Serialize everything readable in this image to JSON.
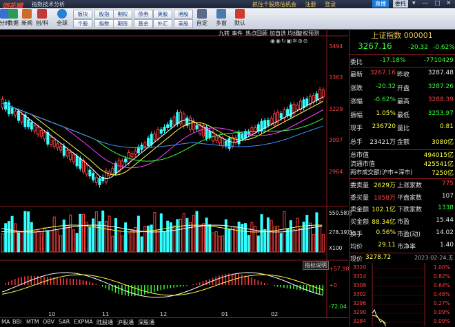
{
  "app": {
    "logo": "同花顺",
    "title": "指数技术分析",
    "links": [
      "抓住个股炼估机会",
      "注册",
      "登录"
    ],
    "live_label": "直播",
    "delegate_label": "委托",
    "window_controls": [
      "▾",
      "—",
      "□",
      "✕"
    ]
  },
  "toolbar": {
    "items": [
      {
        "label": "分时",
        "icon": "timeshare-icon"
      },
      {
        "label": "数据",
        "icon": "data-icon"
      },
      {
        "label": "新闻",
        "icon": "news-icon"
      },
      {
        "label": "创/科",
        "icon": "star-market-icon"
      },
      {
        "label": "全球",
        "icon": "globe-icon"
      }
    ],
    "buttons_row1": [
      "板块",
      "股指",
      "期权",
      "债券",
      "英股",
      "港股"
    ],
    "buttons_row2": [
      "个股",
      "指数",
      "期货",
      "基金",
      "外汇",
      "美股"
    ],
    "right_items": [
      {
        "label": "自定",
        "icon": "custom-icon"
      },
      {
        "label": "多窗",
        "icon": "multiwindow-icon"
      },
      {
        "label": "默认",
        "icon": "home-icon"
      }
    ]
  },
  "chart_toolbar": {
    "items": [
      "九转",
      "事件",
      "热点回顾",
      "加自选",
      "均线",
      "复权",
      "预测"
    ],
    "tool_icons": [
      "eye-icon",
      "eye-icon",
      "refresh-icon",
      "lock-icon",
      "gear-icon",
      "add-icon",
      "minus-icon"
    ]
  },
  "price_axis": [
    "3494",
    "3363",
    "3229",
    "3097",
    "2964"
  ],
  "volume_axis": [
    "550.58万",
    "278.19万",
    "X100"
  ],
  "macd_axis": [
    "+57.98",
    "+0",
    "-72.04"
  ],
  "macd_button": "指标说明",
  "x_axis": [
    "10",
    "11",
    "12",
    "01",
    "02"
  ],
  "bottom_tabs": [
    "MA",
    "BBI",
    "MTM",
    "OBV",
    "SAR",
    "EXPMA",
    "陆股通",
    "沪股通",
    "深股通"
  ],
  "quote_panel": {
    "title": "上证指数 000001",
    "price": "3267.16",
    "change": "-20.32",
    "change_pct": "-0.62%",
    "weibi_label": "委比",
    "weibi": "-17.18%",
    "weicha": "-7710429",
    "rows": [
      {
        "k1": "最新",
        "v1": "3267.16",
        "c1": "red",
        "k2": "昨收",
        "v2": "3287.48",
        "c2": "wht"
      },
      {
        "k1": "涨跌",
        "v1": "-20.32",
        "c1": "grn",
        "k2": "开盘",
        "v2": "3287.26",
        "c2": "grn"
      },
      {
        "k1": "涨幅",
        "v1": "-0.62%",
        "c1": "grn",
        "k2": "最高",
        "v2": "3288.39",
        "c2": "red"
      },
      {
        "k1": "振幅",
        "v1": "1.05%",
        "c1": "yel",
        "k2": "最低",
        "v2": "3253.97",
        "c2": "grn"
      },
      {
        "k1": "现手",
        "v1": "236720",
        "c1": "yel",
        "k2": "量比",
        "v2": "0.81",
        "c2": "yel"
      },
      {
        "k1": "总手",
        "v1": "23421万",
        "c1": "wht",
        "k2": "金额",
        "v2": "3080亿",
        "c2": "yel"
      }
    ],
    "market_rows": [
      {
        "k": "总市值",
        "v": "494015亿"
      },
      {
        "k": "流通市值",
        "v": "425541亿"
      },
      {
        "k": "两市成交额(沪市+深市)",
        "v": "7250亿"
      }
    ],
    "rows2": [
      {
        "k1": "委卖量",
        "v1": "2629万",
        "c1": "yel",
        "k2": "上涨家数",
        "v2": "775",
        "c2": "red"
      },
      {
        "k1": "委买量",
        "v1": "1858万",
        "c1": "red",
        "k2": "平盘家数",
        "v2": "107",
        "c2": "wht"
      },
      {
        "k1": "卖金额",
        "v1": "102.1亿",
        "c1": "yel",
        "k2": "下跌家数",
        "v2": "1338",
        "c2": "grn"
      },
      {
        "k1": "买金额",
        "v1": "88.34亿",
        "c1": "yel",
        "k2": "市盈",
        "v2": "15.44",
        "c2": "wht"
      },
      {
        "k1": "换手",
        "v1": "0.56%",
        "c1": "yel",
        "k2": "市盈(动)",
        "v2": "14.02",
        "c2": "wht"
      },
      {
        "k1": "均价",
        "v1": "29.11",
        "c1": "yel",
        "k2": "市净率",
        "v2": "1.40",
        "c2": "wht"
      }
    ],
    "intraday_label": "现价",
    "intraday_price": "3278.72",
    "intraday_date": "2023-02-24,五",
    "intraday_left_axis": [
      "3320",
      "3314",
      "3308",
      "3302",
      "3296",
      "3290",
      "3284"
    ],
    "intraday_right_axis": [
      "1.00%",
      "0.82%",
      "0.64%",
      "0.46%",
      "0.27%",
      "0.09%",
      "0.09%"
    ]
  },
  "colors": {
    "up": "#ff4040",
    "down": "#33ffff",
    "ma5": "#ffffff",
    "ma10": "#ffff40",
    "ma20": "#ff40ff",
    "ma30": "#40ff40",
    "ma60": "#4090ff"
  }
}
